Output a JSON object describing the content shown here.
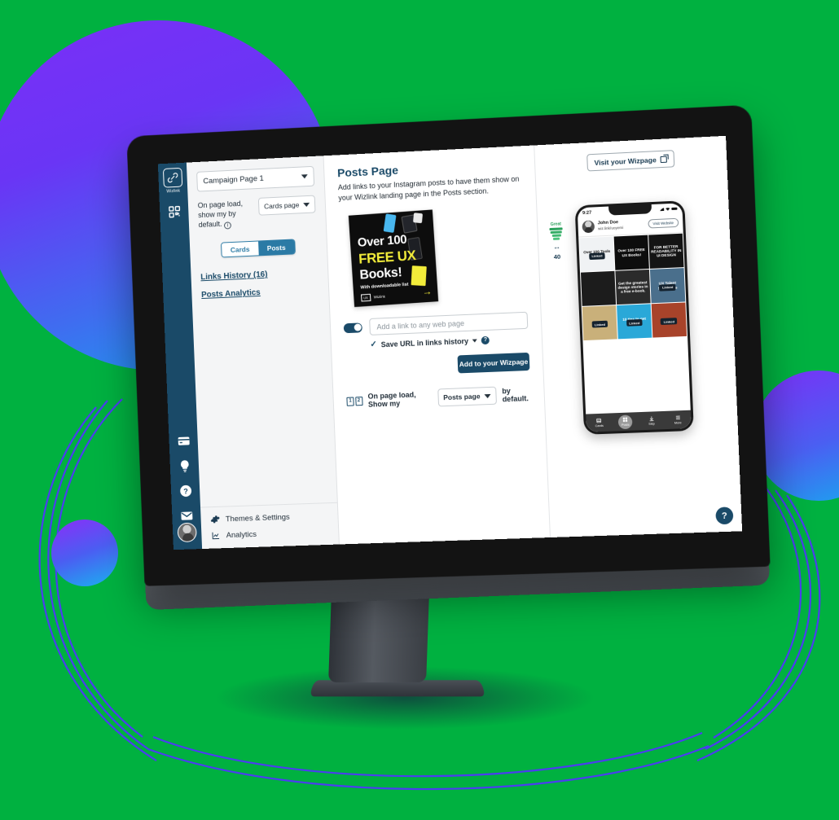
{
  "app": {
    "brand": "Wizlink",
    "rail_icons": [
      "link-logo-icon",
      "qr-grid-icon",
      "wallet-icon",
      "lightbulb-icon",
      "question-circle-icon",
      "envelope-icon",
      "user-avatar"
    ]
  },
  "sidebar": {
    "campaign_select": "Campaign Page 1",
    "onload_label": "On page load, show my",
    "onload_label2": "by default.",
    "onload_value": "Cards page",
    "segmented": [
      {
        "label": "Cards",
        "active": false
      },
      {
        "label": "Posts",
        "active": true
      }
    ],
    "links": [
      "Links History (16)",
      "Posts Analytics"
    ],
    "footer": [
      {
        "label": "Themes & Settings",
        "icon": "gear-icon"
      },
      {
        "label": "Analytics",
        "icon": "chart-line-icon"
      }
    ]
  },
  "main": {
    "title": "Posts Page",
    "description": "Add links to your Instagram posts to have them show on your Wizlink landing page in the Posts section.",
    "post_card": {
      "line1": "Over 100",
      "line2": "FREE UX",
      "line3": "Books!",
      "line4": "With downloadable list",
      "ux_badge": "UX",
      "brand": "Wizlink",
      "arrow": "→"
    },
    "link_input_placeholder": "Add a link to any web page",
    "save_url_label": "Save URL in links history",
    "add_button": "Add to your Wizpage",
    "page_load_prefix": "On page load, Show my",
    "page_load_value": "Posts page",
    "page_load_suffix": "by default.",
    "page_numbers": [
      "1",
      "2"
    ]
  },
  "preview": {
    "visit_button": "Visit your Wizpage",
    "gauge": {
      "label": "Great",
      "value": "40"
    },
    "phone": {
      "time": "9:27",
      "user_name": "John Doe",
      "user_handle": "wiz.link/uoyemi",
      "visit_website": "Visit Website",
      "link_badge": "Linked",
      "grid": [
        {
          "text": "Over 100 Tools for UX/UI",
          "bg": "#f0f2f4",
          "fg": "#101010",
          "badge": true
        },
        {
          "text": "Over 100 FREE UX Books!",
          "bg": "#0d0d0d",
          "fg": "#ffffff",
          "badge": false
        },
        {
          "text": "FOR BETTER READABILITY IN UI DESIGN",
          "bg": "#141414",
          "fg": "#ffffff",
          "badge": false
        },
        {
          "text": "",
          "bg": "#1c1c1c",
          "fg": "#ffffff",
          "badge": false
        },
        {
          "text": "Get the greatest design stories in a free e-book.",
          "bg": "#2b2b2b",
          "fg": "#ffffff",
          "badge": false
        },
        {
          "text": "UX Talent Substance",
          "bg": "#4a6f8c",
          "fg": "#ffffff",
          "badge": true
        },
        {
          "text": "",
          "bg": "#c9b07a",
          "fg": "#111111",
          "badge": true
        },
        {
          "text": "10 tips to get into UX",
          "bg": "#2aa8d8",
          "fg": "#ffffff",
          "badge": true
        },
        {
          "text": "",
          "bg": "#a8432a",
          "fg": "#ffffff",
          "badge": true
        }
      ],
      "nav": [
        {
          "label": "Cards",
          "icon": "rows-icon",
          "active": false
        },
        {
          "label": "Posts",
          "icon": "grid-icon",
          "active": true
        },
        {
          "label": "Skip",
          "icon": "download-icon",
          "active": false
        },
        {
          "label": "More",
          "icon": "menu-icon",
          "active": false
        }
      ]
    },
    "help_fab": "?"
  },
  "theme": {
    "rail_bg": "#1a4a68",
    "accent": "#2b7aa5",
    "button": "#1a4a68",
    "gradient_start": "#7b2ff7",
    "gradient_end": "#13a5ef",
    "gauge_green": "#29a05a"
  }
}
